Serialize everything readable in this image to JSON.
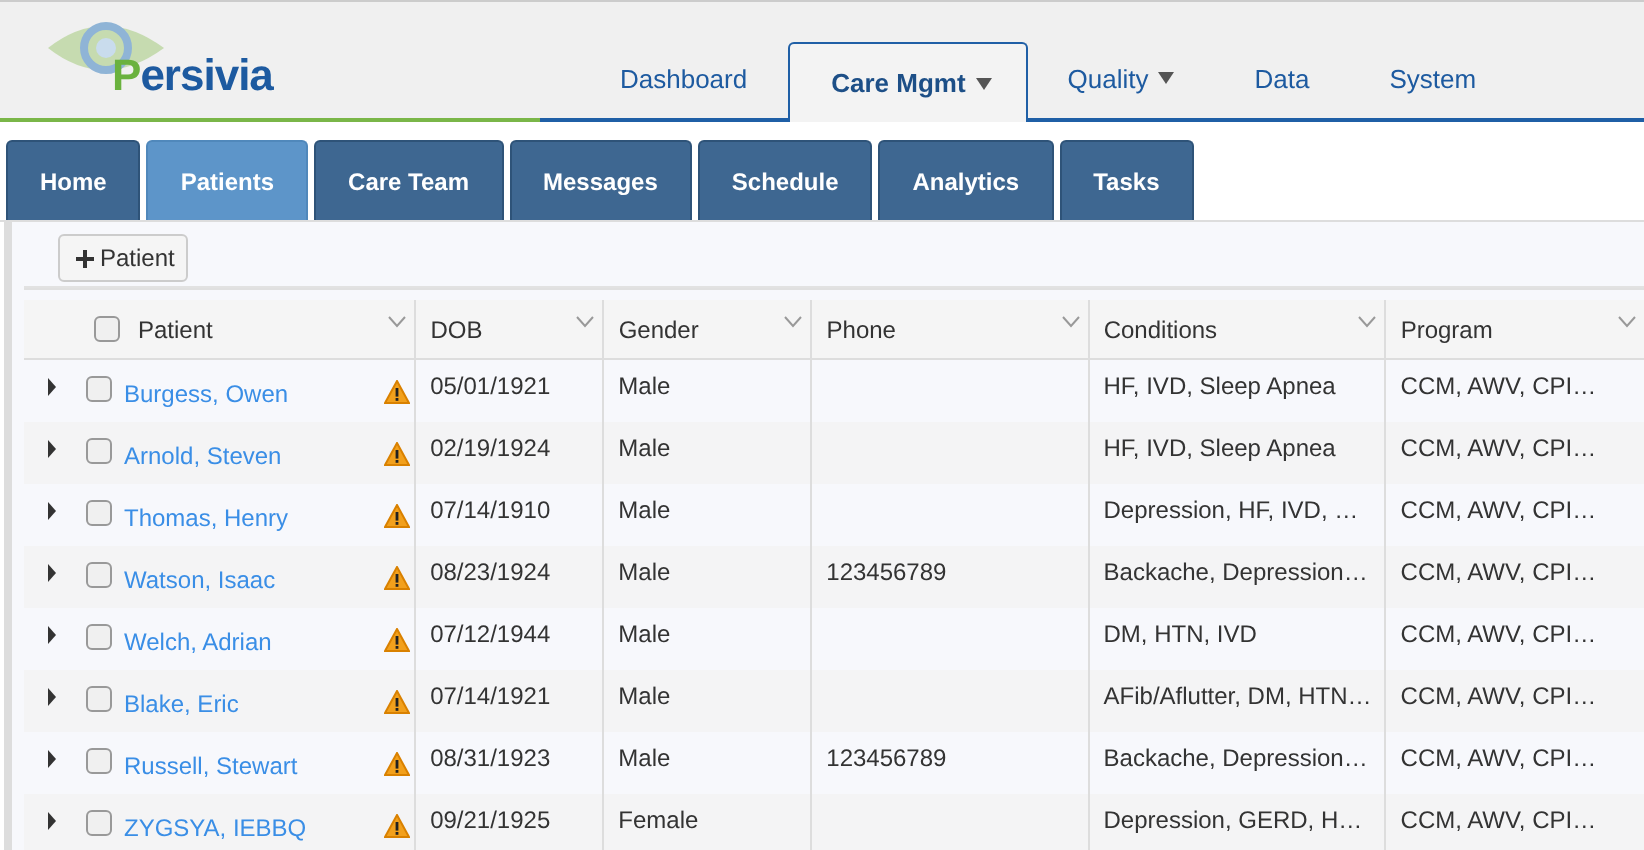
{
  "logo": {
    "text": "Persivia"
  },
  "top_nav": [
    {
      "label": "Dashboard",
      "selected": false,
      "dropdown": false
    },
    {
      "label": "Care Mgmt",
      "selected": true,
      "dropdown": true
    },
    {
      "label": "Quality",
      "selected": false,
      "dropdown": true
    },
    {
      "label": "Data",
      "selected": false,
      "dropdown": false
    },
    {
      "label": "System",
      "selected": false,
      "dropdown": false
    }
  ],
  "tabs": [
    {
      "label": "Home",
      "selected": false
    },
    {
      "label": "Patients",
      "selected": true
    },
    {
      "label": "Care Team",
      "selected": false
    },
    {
      "label": "Messages",
      "selected": false
    },
    {
      "label": "Schedule",
      "selected": false
    },
    {
      "label": "Analytics",
      "selected": false
    },
    {
      "label": "Tasks",
      "selected": false
    }
  ],
  "add_button": {
    "label": "Patient"
  },
  "table": {
    "select_all": {
      "checked": false
    },
    "columns": [
      "Patient",
      "DOB",
      "Gender",
      "Phone",
      "Conditions",
      "Program"
    ],
    "rows": [
      {
        "expanded": false,
        "checked": false,
        "warning": true,
        "patient": "Burgess, Owen",
        "dob": "05/01/1921",
        "gender": "Male",
        "phone": "",
        "conditions": "HF, IVD, Sleep Apnea",
        "program": "CCM, AWV, CPI…"
      },
      {
        "expanded": false,
        "checked": false,
        "warning": true,
        "patient": "Arnold, Steven",
        "dob": "02/19/1924",
        "gender": "Male",
        "phone": "",
        "conditions": "HF, IVD, Sleep Apnea",
        "program": "CCM, AWV, CPI…"
      },
      {
        "expanded": false,
        "checked": false,
        "warning": true,
        "patient": "Thomas, Henry",
        "dob": "07/14/1910",
        "gender": "Male",
        "phone": "",
        "conditions": "Depression, HF, IVD, …",
        "program": "CCM, AWV, CPI…"
      },
      {
        "expanded": false,
        "checked": false,
        "warning": true,
        "patient": "Watson, Isaac",
        "dob": "08/23/1924",
        "gender": "Male",
        "phone": "123456789",
        "conditions": "Backache, Depression…",
        "program": "CCM, AWV, CPI…"
      },
      {
        "expanded": false,
        "checked": false,
        "warning": true,
        "patient": "Welch, Adrian",
        "dob": "07/12/1944",
        "gender": "Male",
        "phone": "",
        "conditions": "DM, HTN, IVD",
        "program": "CCM, AWV, CPI…"
      },
      {
        "expanded": false,
        "checked": false,
        "warning": true,
        "patient": "Blake, Eric",
        "dob": "07/14/1921",
        "gender": "Male",
        "phone": "",
        "conditions": "AFib/Aflutter, DM, HTN…",
        "program": "CCM, AWV, CPI…"
      },
      {
        "expanded": false,
        "checked": false,
        "warning": true,
        "patient": "Russell, Stewart",
        "dob": "08/31/1923",
        "gender": "Male",
        "phone": "123456789",
        "conditions": "Backache, Depression…",
        "program": "CCM, AWV, CPI…"
      },
      {
        "expanded": false,
        "checked": false,
        "warning": true,
        "patient": "ZYGSYA, IEBBQ",
        "dob": "09/21/1925",
        "gender": "Female",
        "phone": "",
        "conditions": "Depression, GERD, H…",
        "program": "CCM, AWV, CPI…"
      }
    ]
  }
}
